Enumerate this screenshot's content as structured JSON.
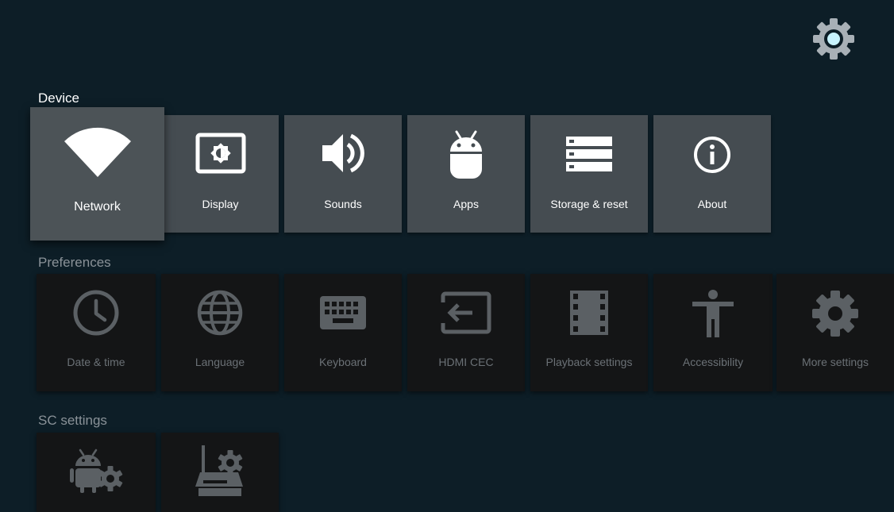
{
  "colors": {
    "background": "#0d1e27",
    "tile_active": "#454c51",
    "tile_dim": "#141516",
    "accent": "#c8f4ff"
  },
  "header": {
    "settings_icon": "settings-gear-icon"
  },
  "sections": {
    "device": {
      "title": "Device",
      "items": [
        {
          "label": "Network",
          "icon": "wifi-icon"
        },
        {
          "label": "Display",
          "icon": "display-brightness-icon"
        },
        {
          "label": "Sounds",
          "icon": "speaker-icon"
        },
        {
          "label": "Apps",
          "icon": "android-icon"
        },
        {
          "label": "Storage & reset",
          "icon": "storage-icon"
        },
        {
          "label": "About",
          "icon": "info-icon"
        }
      ]
    },
    "preferences": {
      "title": "Preferences",
      "items": [
        {
          "label": "Date & time",
          "icon": "clock-icon"
        },
        {
          "label": "Language",
          "icon": "globe-icon"
        },
        {
          "label": "Keyboard",
          "icon": "keyboard-icon"
        },
        {
          "label": "HDMI CEC",
          "icon": "hdmi-input-icon"
        },
        {
          "label": "Playback settings",
          "icon": "film-icon"
        },
        {
          "label": "Accessibility",
          "icon": "accessibility-icon"
        },
        {
          "label": "More settings",
          "icon": "gear-icon"
        }
      ]
    },
    "sc_settings": {
      "title": "SC settings",
      "items": [
        {
          "icon": "android-gear-icon"
        },
        {
          "icon": "router-gear-icon"
        }
      ]
    }
  }
}
